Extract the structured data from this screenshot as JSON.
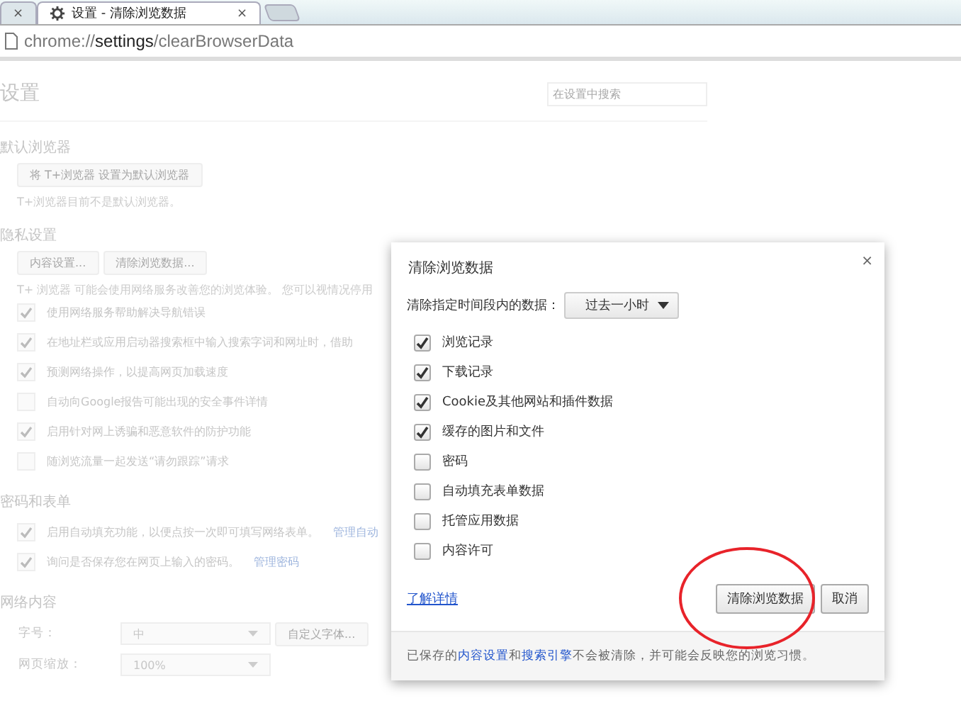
{
  "tabs": [
    {
      "close": "×",
      "selected": false
    },
    {
      "title": "设置 - 清除浏览数据",
      "close": "×",
      "selected": true
    }
  ],
  "address": {
    "scheme": "chrome://",
    "host": "settings",
    "path": "/clearBrowserData"
  },
  "page": {
    "title": "设置",
    "search_placeholder": "在设置中搜索",
    "sections": [
      {
        "heading": "默认浏览器",
        "buttons": [
          "将 T+浏览器 设置为默认浏览器"
        ],
        "note": "T+浏览器目前不是默认浏览器。"
      },
      {
        "heading": "隐私设置",
        "buttons": [
          "内容设置...",
          "清除浏览数据..."
        ],
        "note": "T+ 浏览器 可能会使用网络服务改善您的浏览体验。 您可以视情况停用",
        "options": [
          {
            "label": "使用网络服务帮助解决导航错误",
            "checked": true
          },
          {
            "label": "在地址栏或应用启动器搜索框中输入搜索字词和网址时，借助",
            "checked": true
          },
          {
            "label": "预测网络操作，以提高网页加载速度",
            "checked": true
          },
          {
            "label": "自动向Google报告可能出现的安全事件详情",
            "checked": false
          },
          {
            "label": "启用针对网上诱骗和恶意软件的防护功能",
            "checked": true
          },
          {
            "label": "随浏览流量一起发送“请勿跟踪”请求",
            "checked": false
          }
        ]
      },
      {
        "heading": "密码和表单",
        "options": [
          {
            "label": "启用自动填充功能，以便点按一次即可填写网络表单。",
            "link": "管理自动",
            "checked": true
          },
          {
            "label": "询问是否保存您在网页上输入的密码。",
            "link": "管理密码",
            "checked": true
          }
        ]
      },
      {
        "heading": "网络内容",
        "selects": [
          {
            "label": "字号：",
            "value": "中",
            "button": "自定义字体..."
          },
          {
            "label": "网页缩放：",
            "value": "100%"
          }
        ]
      }
    ]
  },
  "dialog": {
    "title": "清除浏览数据",
    "close": "×",
    "range_label": "清除指定时间段内的数据：",
    "range_value": "过去一小时",
    "items": [
      {
        "label": "浏览记录",
        "checked": true
      },
      {
        "label": "下载记录",
        "checked": true
      },
      {
        "label": "Cookie及其他网站和插件数据",
        "checked": true
      },
      {
        "label": "缓存的图片和文件",
        "checked": true
      },
      {
        "label": "密码",
        "checked": false
      },
      {
        "label": "自动填充表单数据",
        "checked": false
      },
      {
        "label": "托管应用数据",
        "checked": false
      },
      {
        "label": "内容许可",
        "checked": false
      }
    ],
    "learn_more": "了解详情",
    "primary_button": "清除浏览数据",
    "cancel_button": "取消",
    "footer": [
      {
        "kind": "text",
        "text": "已保存的"
      },
      {
        "kind": "link",
        "text": "内容设置"
      },
      {
        "kind": "text",
        "text": "和"
      },
      {
        "kind": "link",
        "text": "搜索引擎"
      },
      {
        "kind": "text",
        "text": "不会被清除，并可能会反映您的浏览习惯。"
      }
    ]
  }
}
